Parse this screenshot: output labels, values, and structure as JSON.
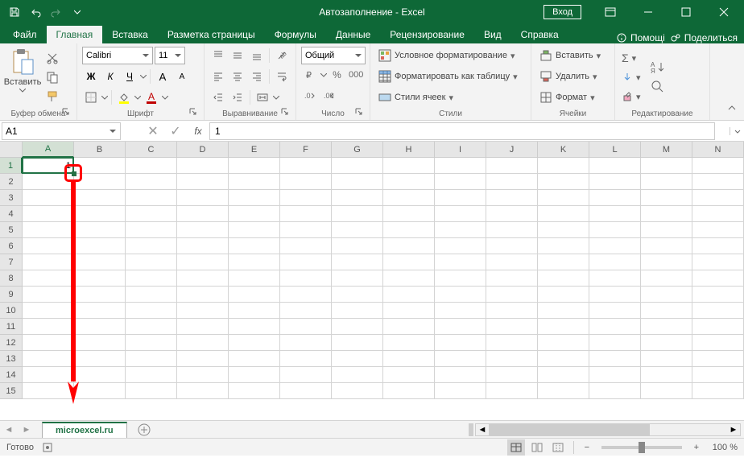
{
  "app": {
    "title": "Автозаполнение  -  Excel",
    "signin": "Вход"
  },
  "tabs": {
    "items": [
      "Файл",
      "Главная",
      "Вставка",
      "Разметка страницы",
      "Формулы",
      "Данные",
      "Рецензирование",
      "Вид",
      "Справка"
    ],
    "active_index": 1,
    "tell_me": "Помощі",
    "share": "Поделиться"
  },
  "ribbon": {
    "clipboard": {
      "label": "Буфер обмена",
      "paste": "Вставить"
    },
    "font": {
      "label": "Шрифт",
      "name": "Calibri",
      "size": "11"
    },
    "align": {
      "label": "Выравнивание"
    },
    "number": {
      "label": "Число",
      "format": "Общий"
    },
    "styles": {
      "label": "Стили",
      "cond": "Условное форматирование",
      "table": "Форматировать как таблицу",
      "cell": "Стили ячеек"
    },
    "cells_group": {
      "label": "Ячейки",
      "insert": "Вставить",
      "delete": "Удалить",
      "format": "Формат"
    },
    "editing": {
      "label": "Редактирование"
    }
  },
  "namebox": {
    "ref": "A1"
  },
  "formula": {
    "value": "1"
  },
  "grid": {
    "columns": [
      "A",
      "B",
      "C",
      "D",
      "E",
      "F",
      "G",
      "H",
      "I",
      "J",
      "K",
      "L",
      "M",
      "N"
    ],
    "rows": [
      "1",
      "2",
      "3",
      "4",
      "5",
      "6",
      "7",
      "8",
      "9",
      "10",
      "11",
      "12",
      "13",
      "14",
      "15"
    ],
    "a1_value": "1"
  },
  "sheet": {
    "name": "microexcel.ru"
  },
  "status": {
    "ready": "Готово",
    "zoom": "100 %"
  }
}
